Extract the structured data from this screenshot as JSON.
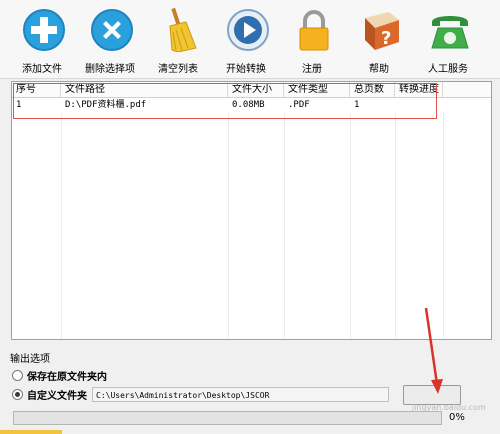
{
  "toolbar": {
    "buttons": [
      {
        "label": "添加文件",
        "icon": "add-icon"
      },
      {
        "label": "删除选择项",
        "icon": "delete-icon"
      },
      {
        "label": "清空列表",
        "icon": "broom-icon"
      },
      {
        "label": "开始转换",
        "icon": "play-icon"
      },
      {
        "label": "注册",
        "icon": "lock-icon"
      },
      {
        "label": "帮助",
        "icon": "help-book-icon"
      },
      {
        "label": "人工服务",
        "icon": "phone-icon"
      }
    ]
  },
  "table": {
    "columns": [
      "序号",
      "文件路径",
      "文件大小",
      "文件类型",
      "总页数",
      "转换进度"
    ],
    "rows": [
      {
        "index": "1",
        "path": "D:\\PDF资料櫃.pdf",
        "size": "0.08MB",
        "type": ".PDF",
        "pages": "1",
        "progress": ""
      }
    ]
  },
  "output": {
    "title": "输出选项",
    "option_original": "保存在原文件夹内",
    "option_custom": "自定义文件夹",
    "custom_path": "C:\\Users\\Administrator\\Desktop\\JSCOR",
    "progress_percent": 0,
    "progress_text": "0%"
  },
  "watermark": "jingyan.baidu.com",
  "colors": {
    "highlight_box": "#e0524a",
    "brand_blue": "#1e8fd0"
  }
}
